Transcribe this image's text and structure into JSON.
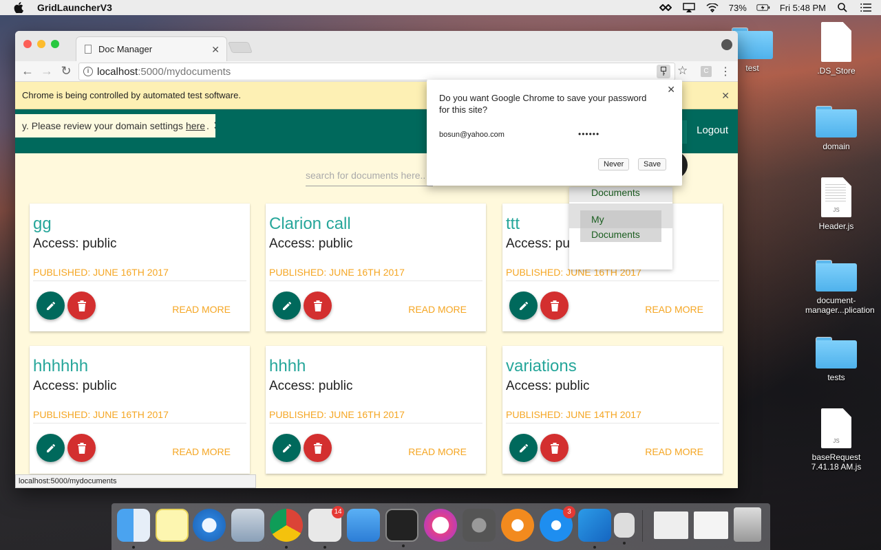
{
  "menubar": {
    "app_name": "GridLauncherV3",
    "battery": "73%",
    "clock": "Fri 5:48 PM"
  },
  "desktop": {
    "items": [
      {
        "label": "test",
        "kind": "folder"
      },
      {
        "label": ".DS_Store",
        "kind": "file"
      },
      {
        "label": "domain",
        "kind": "folder"
      },
      {
        "label": "Header.js",
        "kind": "file"
      },
      {
        "label": "document-manager...plication",
        "kind": "folder"
      },
      {
        "label": "tests",
        "kind": "folder"
      },
      {
        "label": "baseRequest 7.41.18 AM.js",
        "kind": "file"
      }
    ]
  },
  "browser": {
    "tab_title": "Doc Manager",
    "url_host": "localhost",
    "url_rest": ":5000/mydocuments",
    "infobar": "Chrome is being controlled by automated test software.",
    "status_url": "localhost:5000/mydocuments",
    "ext_letter": "C"
  },
  "app": {
    "toast_text": "y. Please review your domain settings",
    "toast_link": "here",
    "toast_dot": ".",
    "logout": "Logout",
    "search_placeholder": "search for documents here..",
    "dropdown": {
      "item1": "Documents",
      "item2": "My Documents"
    },
    "access_prefix": "Access: public",
    "read_more": "READ MORE",
    "cards": [
      {
        "title": "gg",
        "access": "Access: public",
        "published": "PUBLISHED: JUNE 16TH 2017"
      },
      {
        "title": "Clarion call",
        "access": "Access: public",
        "published": "PUBLISHED: JUNE 16TH 2017"
      },
      {
        "title": "ttt",
        "access": "Access: public",
        "published": "PUBLISHED: JUNE 16TH 2017"
      },
      {
        "title": "hhhhhh",
        "access": "Access: public",
        "published": "PUBLISHED: JUNE 16TH 2017"
      },
      {
        "title": "hhhh",
        "access": "Access: public",
        "published": "PUBLISHED: JUNE 16TH 2017"
      },
      {
        "title": "variations",
        "access": "Access: public",
        "published": "PUBLISHED: JUNE 14TH 2017"
      }
    ]
  },
  "password_popup": {
    "question": "Do you want Google Chrome to save your password for this site?",
    "username": "bosun@yahoo.com",
    "password_mask": "••••••",
    "never": "Never",
    "save": "Save"
  },
  "dock": {
    "badges": {
      "slack": "14",
      "appstore": "3"
    }
  },
  "colors": {
    "primary": "#00695c",
    "accent_title": "#26a69a",
    "published": "#f5a623",
    "delete": "#d32f2f",
    "content_bg": "#fff9dc"
  }
}
